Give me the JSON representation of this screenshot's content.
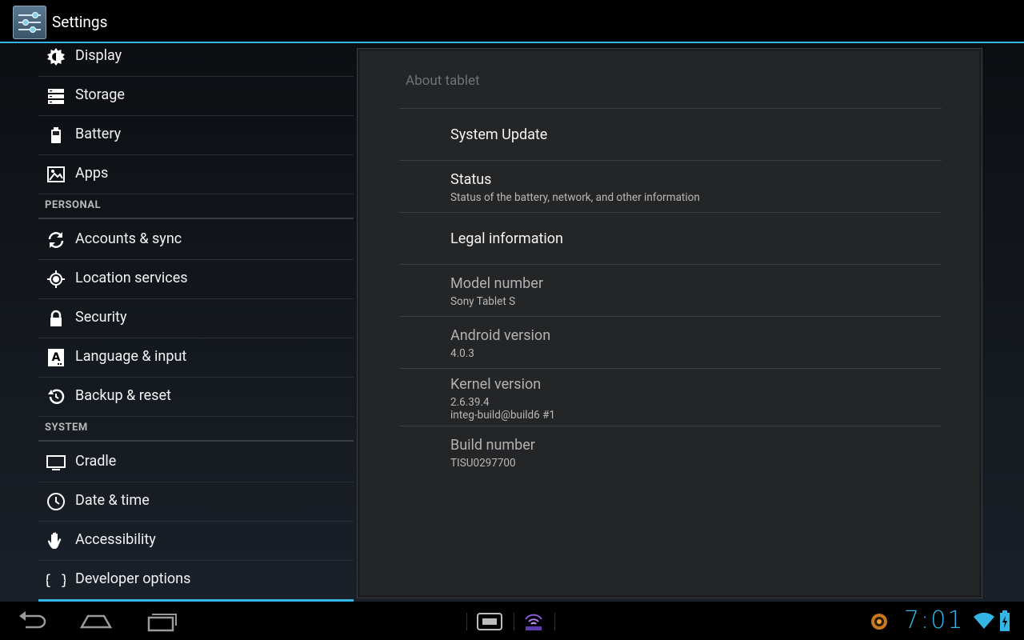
{
  "app": {
    "title": "Settings"
  },
  "sidebar": {
    "items": [
      {
        "key": "display",
        "label": "Display",
        "icon": "display-icon"
      },
      {
        "key": "storage",
        "label": "Storage",
        "icon": "storage-icon"
      },
      {
        "key": "battery",
        "label": "Battery",
        "icon": "battery-icon"
      },
      {
        "key": "apps",
        "label": "Apps",
        "icon": "apps-icon"
      }
    ],
    "personal_header": "PERSONAL",
    "personal": [
      {
        "key": "accounts",
        "label": "Accounts & sync",
        "icon": "sync-icon"
      },
      {
        "key": "location",
        "label": "Location services",
        "icon": "location-icon"
      },
      {
        "key": "security",
        "label": "Security",
        "icon": "lock-icon"
      },
      {
        "key": "language",
        "label": "Language & input",
        "icon": "language-icon"
      },
      {
        "key": "backup",
        "label": "Backup & reset",
        "icon": "backup-icon"
      }
    ],
    "system_header": "SYSTEM",
    "system": [
      {
        "key": "cradle",
        "label": "Cradle",
        "icon": "monitor-icon"
      },
      {
        "key": "datetime",
        "label": "Date & time",
        "icon": "clock-icon"
      },
      {
        "key": "accessibility",
        "label": "Accessibility",
        "icon": "hand-icon"
      },
      {
        "key": "developer",
        "label": "Developer options",
        "icon": "braces-icon"
      }
    ]
  },
  "about": {
    "title": "About tablet",
    "system_update": "System Update",
    "status_title": "Status",
    "status_summary": "Status of the battery, network, and other information",
    "legal": "Legal information",
    "model_title": "Model number",
    "model_value": "Sony Tablet S",
    "android_title": "Android version",
    "android_value": "4.0.3",
    "kernel_title": "Kernel version",
    "kernel_line1": "2.6.39.4",
    "kernel_line2": "integ-build@build6 #1",
    "build_title": "Build number",
    "build_value": "TISU0297700"
  },
  "statusbar": {
    "clock": "7:01"
  },
  "colors": {
    "accent": "#33b5e5",
    "panel_bg": "#242527"
  }
}
